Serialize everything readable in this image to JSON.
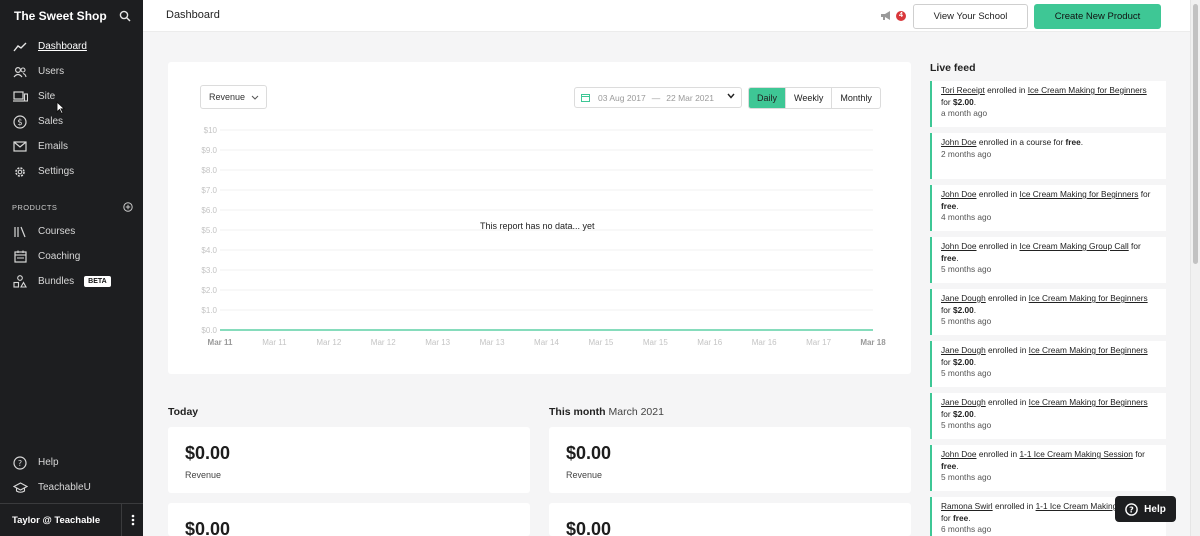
{
  "sidebar": {
    "school_name": "The Sweet Shop",
    "nav": [
      {
        "label": "Dashboard",
        "icon": "trend-line-icon",
        "active": true
      },
      {
        "label": "Users",
        "icon": "users-icon"
      },
      {
        "label": "Site",
        "icon": "devices-icon"
      },
      {
        "label": "Sales",
        "icon": "dollar-circle-icon"
      },
      {
        "label": "Emails",
        "icon": "envelope-icon"
      },
      {
        "label": "Settings",
        "icon": "gear-icon"
      }
    ],
    "products_section": "PRODUCTS",
    "products": [
      {
        "label": "Courses",
        "icon": "library-icon"
      },
      {
        "label": "Coaching",
        "icon": "calendar-icon"
      },
      {
        "label": "Bundles",
        "icon": "shapes-icon",
        "badge": "BETA"
      }
    ],
    "footer_nav": [
      {
        "label": "Help",
        "icon": "question-circle-icon"
      },
      {
        "label": "TeachableU",
        "icon": "graduation-cap-icon"
      }
    ],
    "user": "Taylor @ Teachable"
  },
  "topbar": {
    "title": "Dashboard",
    "notification_count": "4",
    "view_school": "View Your School",
    "create_product": "Create New Product"
  },
  "chart_controls": {
    "metric": "Revenue",
    "date_start": "03 Aug 2017",
    "date_sep": "—",
    "date_end": "22 Mar 2021",
    "granularity": [
      "Daily",
      "Weekly",
      "Monthly"
    ],
    "granularity_selected": "Daily",
    "empty_message": "This report has no data... yet"
  },
  "chart_data": {
    "type": "line",
    "title": "",
    "xlabel": "",
    "ylabel": "",
    "y_ticks": [
      "$10",
      "$9.0",
      "$8.0",
      "$7.0",
      "$6.0",
      "$5.0",
      "$4.0",
      "$3.0",
      "$2.0",
      "$1.0",
      "$0.0"
    ],
    "x_ticks": [
      "Mar 11",
      "Mar 11",
      "Mar 12",
      "Mar 12",
      "Mar 13",
      "Mar 13",
      "Mar 14",
      "Mar 15",
      "Mar 15",
      "Mar 16",
      "Mar 16",
      "Mar 17",
      "Mar 18"
    ],
    "ylim": [
      0,
      10
    ],
    "series": [
      {
        "values": [
          0,
          0,
          0,
          0,
          0,
          0,
          0,
          0,
          0,
          0,
          0,
          0,
          0
        ]
      }
    ],
    "grid": true,
    "line_color": "#3ec795"
  },
  "summary": {
    "today_label": "Today",
    "month_label": "This month",
    "month_value": "March 2021",
    "today_revenue": "$0.00",
    "month_revenue": "$0.00",
    "today_second": "$0.00",
    "month_second": "$0.00",
    "revenue_label": "Revenue"
  },
  "live_feed": {
    "title": "Live feed",
    "items": [
      {
        "user": "Tori Receipt",
        "verb": " enrolled in ",
        "target": "Ice Cream Making for Beginners",
        "pre_price": " for ",
        "price": "$2.00",
        "time": "a month ago"
      },
      {
        "user": "John Doe",
        "verb": " enrolled in a course for ",
        "target": "",
        "pre_price": "",
        "price": "free",
        "time": "2 months ago"
      },
      {
        "user": "John Doe",
        "verb": " enrolled in ",
        "target": "Ice Cream Making for Beginners",
        "pre_price": " for ",
        "price": "free",
        "time": "4 months ago"
      },
      {
        "user": "John Doe",
        "verb": " enrolled in ",
        "target": "Ice Cream Making Group Call",
        "pre_price": " for ",
        "price": "free",
        "time": "5 months ago"
      },
      {
        "user": "Jane Dough",
        "verb": " enrolled in ",
        "target": "Ice Cream Making for Beginners",
        "pre_price": " for ",
        "price": "$2.00",
        "time": "5 months ago"
      },
      {
        "user": "Jane Dough",
        "verb": " enrolled in ",
        "target": "Ice Cream Making for Beginners",
        "pre_price": " for ",
        "price": "$2.00",
        "time": "5 months ago"
      },
      {
        "user": "Jane Dough",
        "verb": " enrolled in ",
        "target": "Ice Cream Making for Beginners",
        "pre_price": " for ",
        "price": "$2.00",
        "time": "5 months ago"
      },
      {
        "user": "John Doe",
        "verb": " enrolled in ",
        "target": "1-1 Ice Cream Making Session",
        "pre_price": " for ",
        "price": "free",
        "time": "5 months ago"
      },
      {
        "user": "Ramona Swirl",
        "verb": " enrolled in ",
        "target": "1-1 Ice Cream Making Session",
        "pre_price": " for ",
        "price": "free",
        "time": "6 months ago"
      }
    ]
  },
  "help_button": "Help",
  "colors": {
    "accent": "#3ec795",
    "sidebar": "#1d1e20",
    "badge": "#d9373b"
  }
}
